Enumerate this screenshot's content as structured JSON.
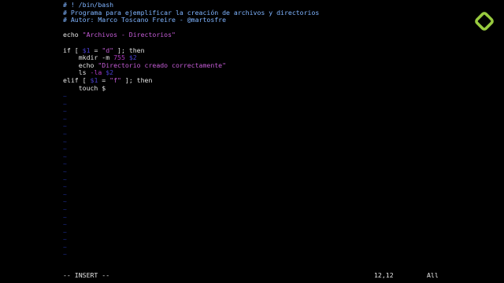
{
  "editor": {
    "lines": [
      {
        "segments": [
          {
            "text": "# ! /bin/bash",
            "cls": "comment"
          }
        ]
      },
      {
        "segments": [
          {
            "text": "# Programa para ejemplificar la creación de archivos y directorios",
            "cls": "comment"
          }
        ]
      },
      {
        "segments": [
          {
            "text": "# Autor: Marco Toscano Freire - @martosfre",
            "cls": "comment"
          }
        ]
      },
      {
        "segments": [
          {
            "text": "",
            "cls": "plain"
          }
        ]
      },
      {
        "segments": [
          {
            "text": "echo ",
            "cls": "plain"
          },
          {
            "text": "\"Archivos - Directorios\"",
            "cls": "str"
          }
        ]
      },
      {
        "segments": [
          {
            "text": "",
            "cls": "plain"
          }
        ]
      },
      {
        "segments": [
          {
            "text": "if [ ",
            "cls": "plain"
          },
          {
            "text": "$1",
            "cls": "var"
          },
          {
            "text": " = ",
            "cls": "plain"
          },
          {
            "text": "\"d\"",
            "cls": "str"
          },
          {
            "text": " ]; then",
            "cls": "plain"
          }
        ]
      },
      {
        "segments": [
          {
            "text": "    mkdir -m ",
            "cls": "plain"
          },
          {
            "text": "755",
            "cls": "num"
          },
          {
            "text": " ",
            "cls": "plain"
          },
          {
            "text": "$2",
            "cls": "var"
          }
        ]
      },
      {
        "segments": [
          {
            "text": "    echo ",
            "cls": "plain"
          },
          {
            "text": "\"Directorio creado correctamente\"",
            "cls": "str"
          }
        ]
      },
      {
        "segments": [
          {
            "text": "    ls ",
            "cls": "plain"
          },
          {
            "text": "-la",
            "cls": "num"
          },
          {
            "text": " ",
            "cls": "plain"
          },
          {
            "text": "$2",
            "cls": "var"
          }
        ]
      },
      {
        "segments": [
          {
            "text": "elif [ ",
            "cls": "plain"
          },
          {
            "text": "$1",
            "cls": "var"
          },
          {
            "text": " = ",
            "cls": "plain"
          },
          {
            "text": "\"f\"",
            "cls": "str"
          },
          {
            "text": " ]; then",
            "cls": "plain"
          }
        ]
      },
      {
        "segments": [
          {
            "text": "    touch $",
            "cls": "plain"
          }
        ]
      }
    ],
    "empty_line_marker": "~",
    "empty_line_count": 22
  },
  "statusbar": {
    "mode": "-- INSERT --",
    "cursor_position": "12,12",
    "scroll": "All"
  },
  "logo": {
    "icon": "platzi-logo-icon",
    "color": "#98ca3f"
  },
  "colors": {
    "background": "#000000",
    "comment": "#7fb4ff",
    "string": "#c45cd6",
    "variable": "#4a3fd0",
    "tilde": "#1c2a8a"
  }
}
